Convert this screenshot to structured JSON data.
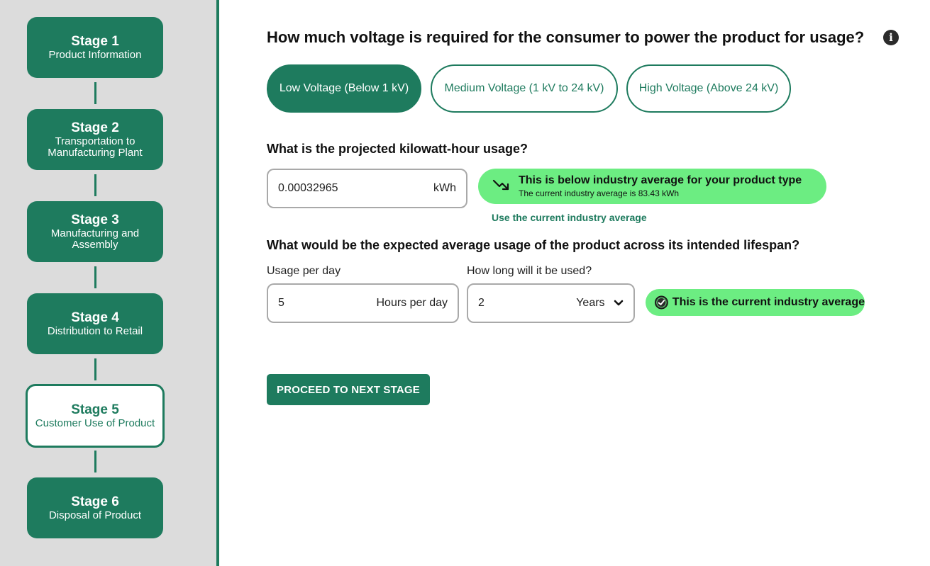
{
  "sidebar": {
    "stages": [
      {
        "title": "Stage 1",
        "subtitle": "Product Information"
      },
      {
        "title": "Stage 2",
        "subtitle": "Transportation to Manufacturing Plant"
      },
      {
        "title": "Stage 3",
        "subtitle": "Manufacturing and Assembly"
      },
      {
        "title": "Stage 4",
        "subtitle": "Distribution to Retail"
      },
      {
        "title": "Stage 5",
        "subtitle": "Customer Use of Product"
      },
      {
        "title": "Stage 6",
        "subtitle": "Disposal of Product"
      }
    ],
    "active_stage": "Stage 5"
  },
  "voltage": {
    "question": "How much voltage is required for the consumer to power the product for usage?",
    "info_icon": "info-icon",
    "options": [
      "Low Voltage (Below 1 kV)",
      "Medium Voltage (1 kV to 24 kV)",
      "High Voltage (Above 24 kV)"
    ],
    "selected": "Low Voltage (Below 1 kV)"
  },
  "kwh": {
    "question": "What is the projected kilowatt-hour usage?",
    "value": "0.00032965",
    "unit": "kWh",
    "badge_title": "This is below industry average for your product type",
    "badge_sub": "The current industry average is 83.43 kWh",
    "badge_icon": "trending-down-icon",
    "link": "Use the current industry average"
  },
  "lifespan": {
    "question": "What would be the expected average usage of the product across its intended lifespan?",
    "usage_label": "Usage per day",
    "usage_value": "5",
    "usage_unit": "Hours per day",
    "duration_label": "How long will it be used?",
    "duration_value": "2",
    "duration_unit": "Years",
    "badge": "This is the current industry average",
    "badge_icon": "check-circle-icon"
  },
  "proceed_label": "PROCEED TO NEXT STAGE",
  "colors": {
    "brand_green": "#1e7b5e",
    "badge_green": "#6ced82",
    "sidebar_bg": "#dcdcdc"
  }
}
